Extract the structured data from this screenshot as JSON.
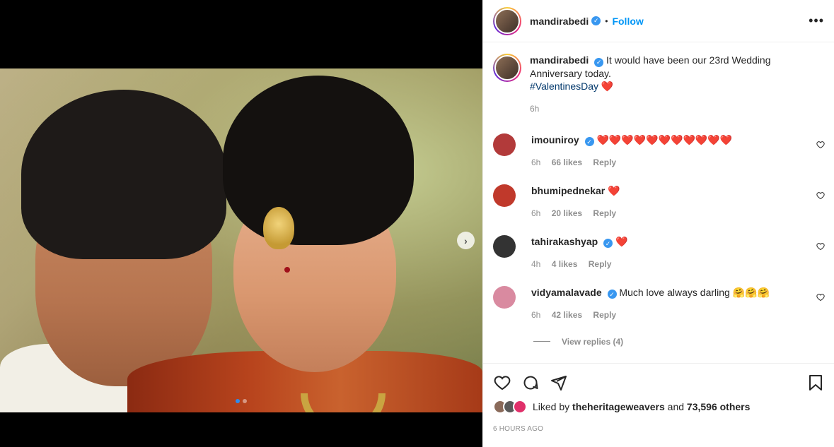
{
  "post": {
    "username": "mandirabedi",
    "follow_label": "Follow",
    "sep": "•",
    "more": "•••",
    "verified_mark": "✓",
    "caption_text": "It would have been our 23rd Wedding Anniversary today.",
    "caption_hashtag": "#ValentinesDay",
    "caption_emoji": "❤️",
    "caption_time": "6h",
    "next_arrow": "›"
  },
  "comments": [
    {
      "username": "imouniroy",
      "verified": true,
      "text": "❤️❤️❤️❤️❤️❤️❤️❤️❤️❤️❤️",
      "time": "6h",
      "likes": "66 likes",
      "reply": "Reply",
      "avatar_color": "#b23a3a"
    },
    {
      "username": "bhumipednekar",
      "verified": false,
      "text": "❤️",
      "time": "6h",
      "likes": "20 likes",
      "reply": "Reply",
      "avatar_color": "#c0392b"
    },
    {
      "username": "tahirakashyap",
      "verified": true,
      "text": "❤️",
      "time": "4h",
      "likes": "4 likes",
      "reply": "Reply",
      "avatar_color": "#333333"
    },
    {
      "username": "vidyamalavade",
      "verified": true,
      "text": "Much love always darling 🤗🤗🤗",
      "time": "6h",
      "likes": "42 likes",
      "reply": "Reply",
      "avatar_color": "#d98aa0"
    }
  ],
  "view_replies": "View replies (4)",
  "likes_line": {
    "prefix": "Liked by",
    "user": "theheritageweavers",
    "suffix": "and",
    "count": "73,596 others"
  },
  "posted_time": "6 HOURS AGO",
  "colors": {
    "accent": "#0095f6",
    "verified": "#3897f0",
    "heart": "#e0142c"
  }
}
